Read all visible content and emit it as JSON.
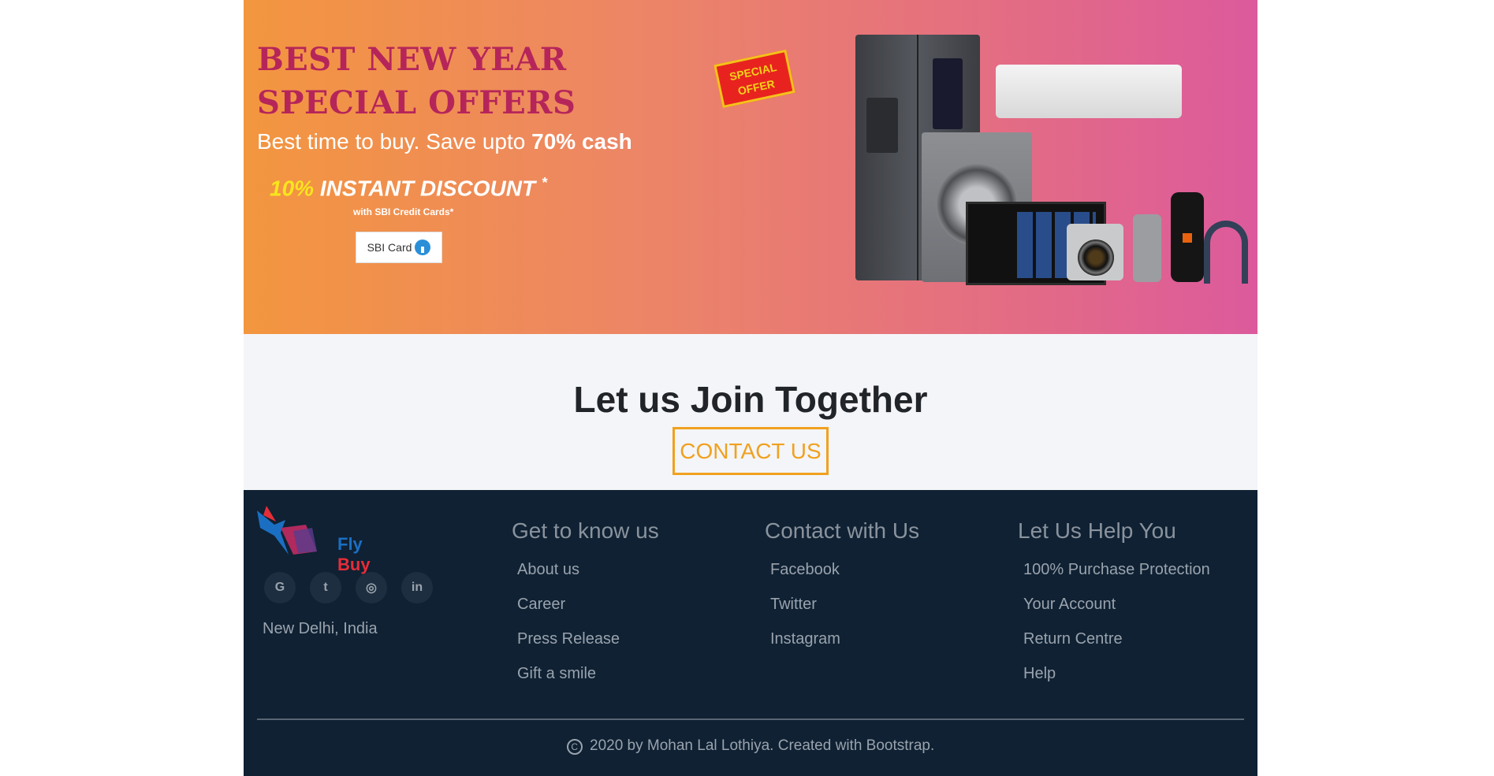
{
  "banner": {
    "title_line1": "BEST NEW YEAR",
    "title_line2": "SPECIAL OFFERS",
    "subtitle_prefix": "Best time to buy. Save upto ",
    "subtitle_highlight": "70% cash",
    "discount_percent": "10%",
    "discount_text": " INSTANT DISCOUNT",
    "discount_star": "*",
    "discount_note": "with SBI Credit Cards*",
    "card_label": "SBI Card",
    "special_offer_badge": "SPECIAL OFFER"
  },
  "join": {
    "title": "Let us Join Together",
    "button_label": "CONTACT US"
  },
  "footer": {
    "brand_fly": "Fly",
    "brand_buy": "Buy",
    "socials": [
      "G",
      "t",
      "◎",
      "in"
    ],
    "location": "New Delhi, India",
    "columns": [
      {
        "title": "Get to know us",
        "links": [
          "About us",
          "Career",
          "Press Release",
          "Gift a smile"
        ]
      },
      {
        "title": "Contact with Us",
        "links": [
          "Facebook",
          "Twitter",
          "Instagram"
        ]
      },
      {
        "title": "Let Us Help You",
        "links": [
          "100% Purchase Protection",
          "Your Account",
          "Return Centre",
          "Help"
        ]
      }
    ],
    "copyright_symbol": "C",
    "copyright": "2020 by Mohan Lal Lothiya. Created with Bootstrap."
  },
  "colors": {
    "accent": "#f0a11f",
    "banner_title": "#b5255a",
    "footer_bg": "#0f2133"
  }
}
